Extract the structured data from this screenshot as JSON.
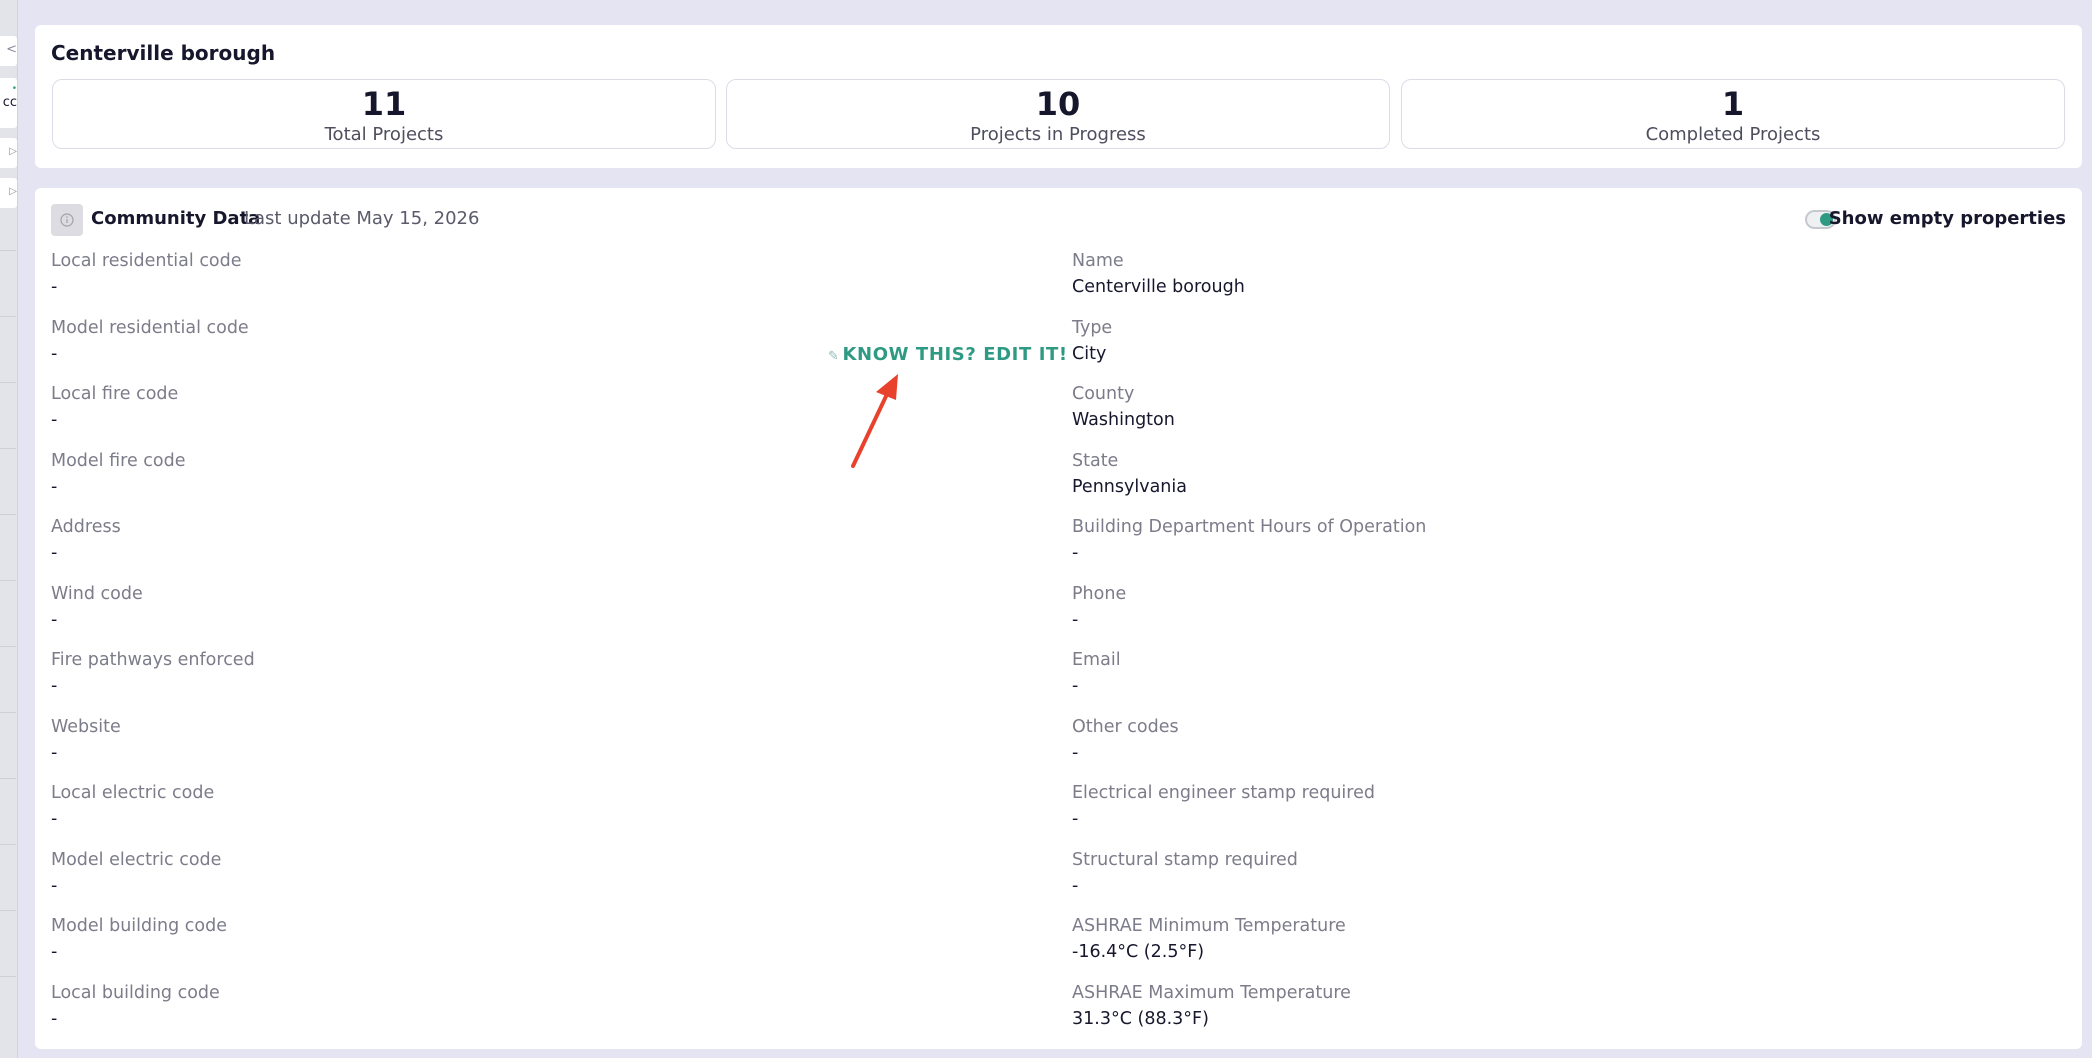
{
  "sidebar_strip": {
    "tab_glyphs": [
      "<",
      "•",
      "▷",
      "▷"
    ],
    "partial_text": "cc"
  },
  "header": {
    "title": "Centerville borough"
  },
  "stats": [
    {
      "value": "11",
      "label": "Total Projects"
    },
    {
      "value": "10",
      "label": "Projects in Progress"
    },
    {
      "value": "1",
      "label": "Completed Projects"
    }
  ],
  "community": {
    "info_icon": "info-circle-icon",
    "title": "Community Data",
    "last_update": "Last update May 15, 2026",
    "toggle_label": "Show empty properties",
    "toggle_on": true,
    "edit_link": "KNOW THIS? EDIT IT!",
    "left_fields": [
      {
        "label": "Local residential code",
        "value": "-"
      },
      {
        "label": "Model residential code",
        "value": "-"
      },
      {
        "label": "Local fire code",
        "value": "-"
      },
      {
        "label": "Model fire code",
        "value": "-"
      },
      {
        "label": "Address",
        "value": "-"
      },
      {
        "label": "Wind code",
        "value": "-"
      },
      {
        "label": "Fire pathways enforced",
        "value": "-"
      },
      {
        "label": "Website",
        "value": "-"
      },
      {
        "label": "Local electric code",
        "value": "-"
      },
      {
        "label": "Model electric code",
        "value": "-"
      },
      {
        "label": "Model building code",
        "value": "-"
      },
      {
        "label": "Local building code",
        "value": "-"
      }
    ],
    "right_fields": [
      {
        "label": "Name",
        "value": "Centerville borough"
      },
      {
        "label": "Type",
        "value": "City"
      },
      {
        "label": "County",
        "value": "Washington"
      },
      {
        "label": "State",
        "value": "Pennsylvania"
      },
      {
        "label": "Building Department Hours of Operation",
        "value": "-"
      },
      {
        "label": "Phone",
        "value": "-"
      },
      {
        "label": "Email",
        "value": "-"
      },
      {
        "label": "Other codes",
        "value": "-"
      },
      {
        "label": "Electrical engineer stamp required",
        "value": "-"
      },
      {
        "label": "Structural stamp required",
        "value": "-"
      },
      {
        "label": "ASHRAE Minimum Temperature",
        "value": "-16.4°C (2.5°F)"
      },
      {
        "label": "ASHRAE Maximum Temperature",
        "value": "31.3°C (88.3°F)"
      }
    ]
  },
  "colors": {
    "accent": "#2f9a83",
    "annotation_arrow": "#e8412c",
    "page_bg": "#e5e4f3"
  }
}
